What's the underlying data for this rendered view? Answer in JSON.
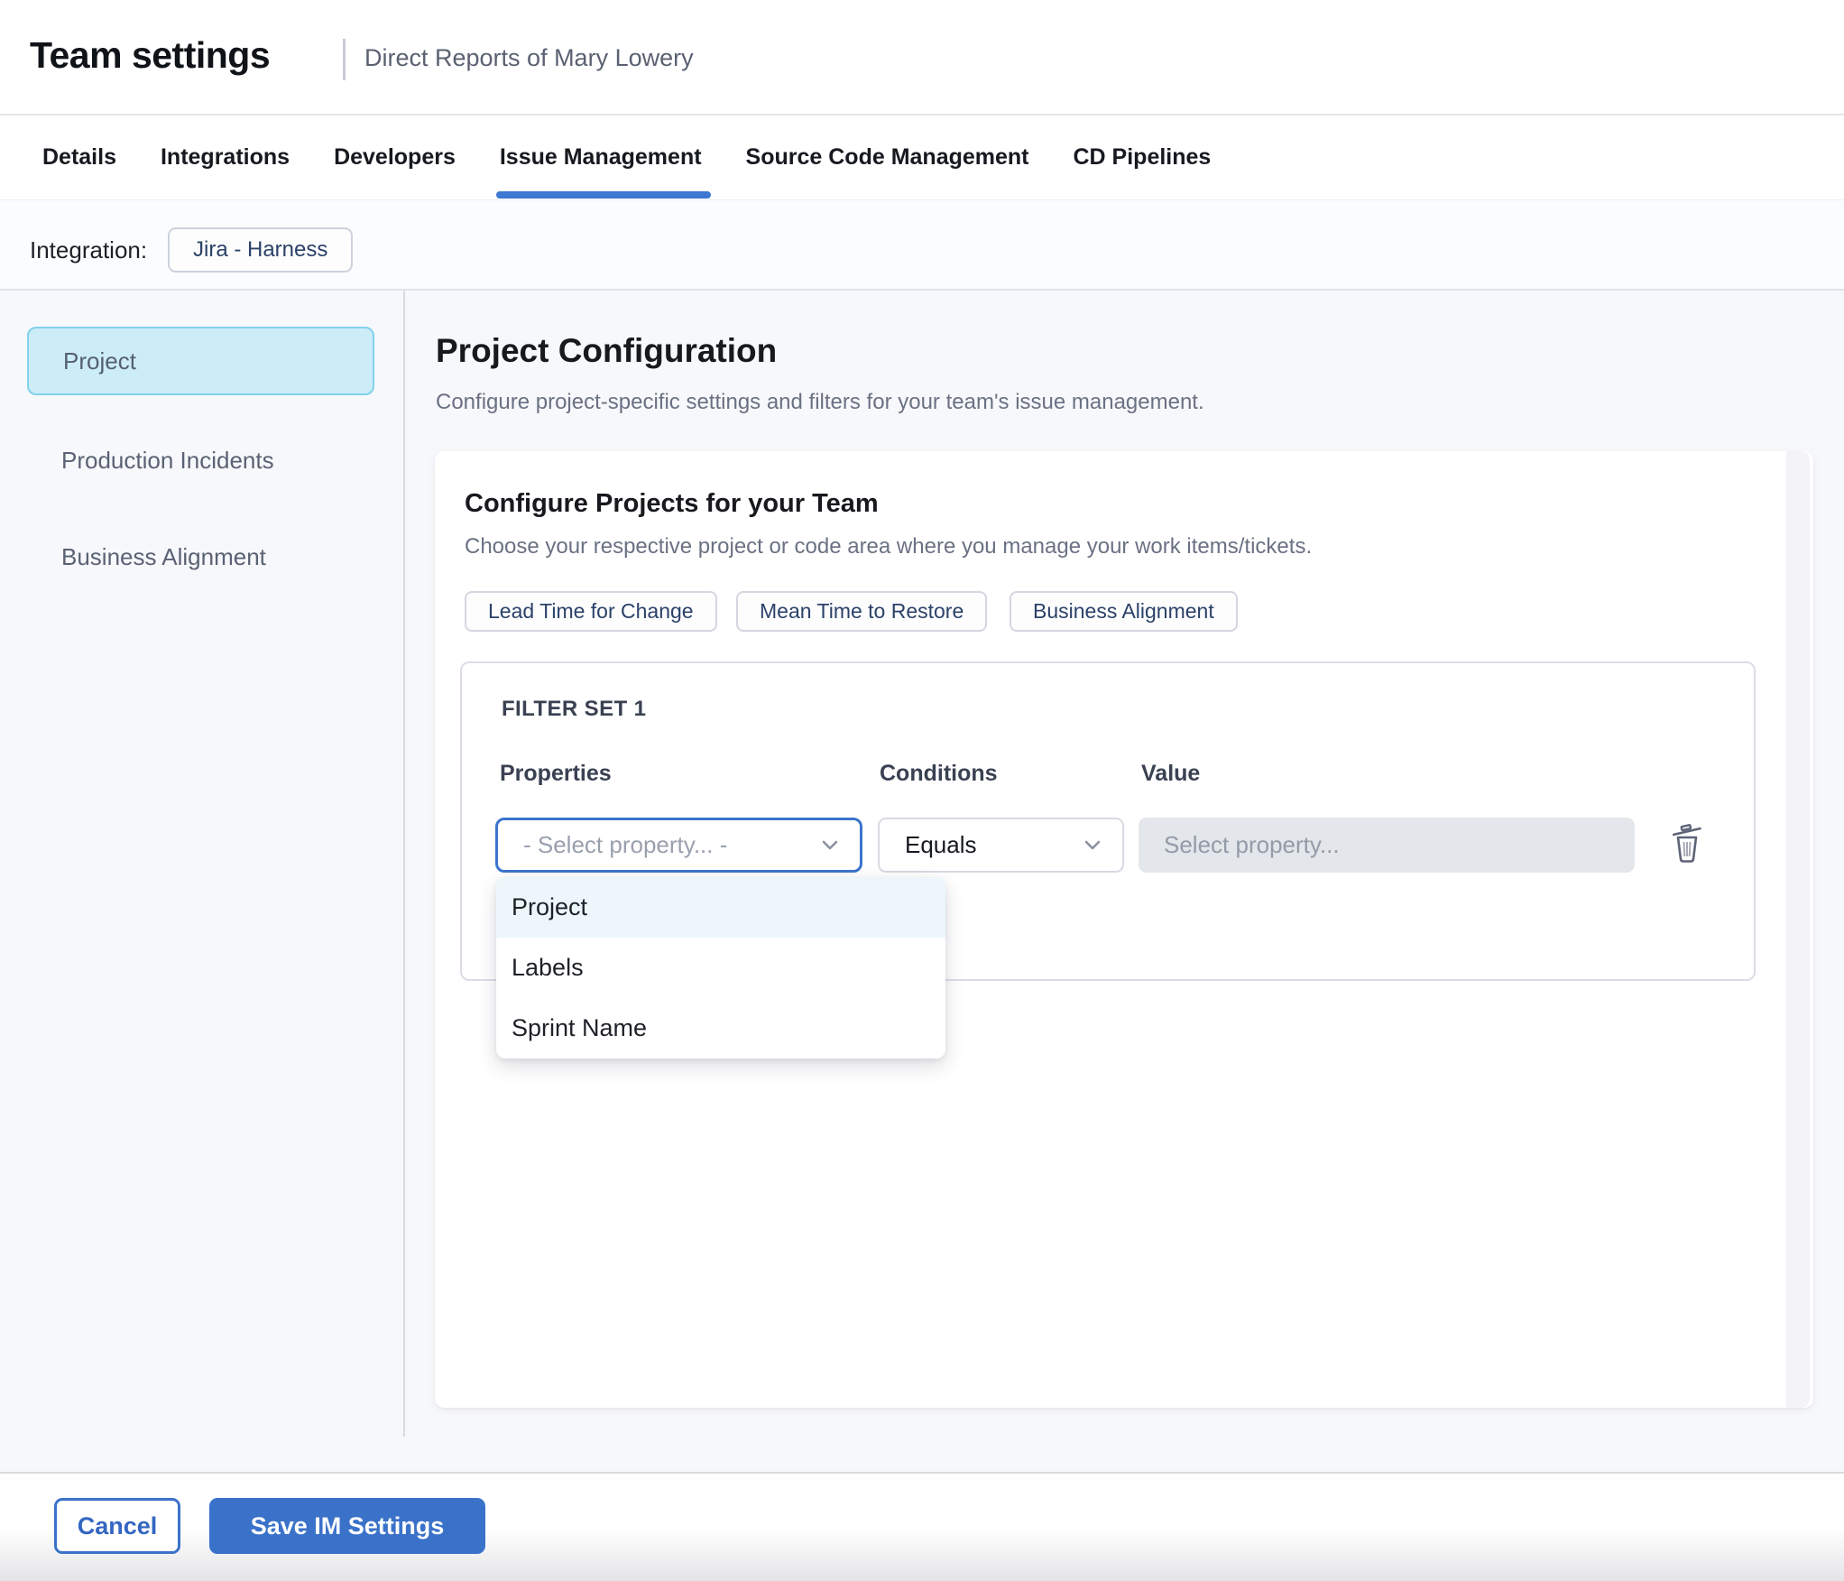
{
  "header": {
    "title": "Team settings",
    "subtitle": "Direct Reports of Mary Lowery"
  },
  "tabs": [
    {
      "label": "Details",
      "active": false
    },
    {
      "label": "Integrations",
      "active": false
    },
    {
      "label": "Developers",
      "active": false
    },
    {
      "label": "Issue Management",
      "active": true
    },
    {
      "label": "Source Code Management",
      "active": false
    },
    {
      "label": "CD Pipelines",
      "active": false
    }
  ],
  "integration": {
    "label": "Integration:",
    "chip": "Jira - Harness"
  },
  "sidebar": {
    "items": [
      {
        "label": "Project",
        "active": true
      },
      {
        "label": "Production Incidents",
        "active": false
      },
      {
        "label": "Business Alignment",
        "active": false
      }
    ]
  },
  "main": {
    "heading": "Project Configuration",
    "description": "Configure project-specific settings and filters for your team's issue management.",
    "card": {
      "title": "Configure Projects for your Team",
      "description": "Choose your respective project or code area where you manage your work items/tickets.",
      "chips": [
        "Lead Time for Change",
        "Mean Time to Restore",
        "Business Alignment"
      ],
      "filter_set": {
        "title": "FILTER SET 1",
        "columns": [
          "Properties",
          "Conditions",
          "Value"
        ],
        "property_placeholder": "- Select property... -",
        "condition_value": "Equals",
        "value_placeholder": "Select property...",
        "dropdown_options": [
          {
            "label": "Project",
            "highlighted": true
          },
          {
            "label": "Labels",
            "highlighted": false
          },
          {
            "label": "Sprint Name",
            "highlighted": false
          }
        ]
      }
    }
  },
  "footer": {
    "cancel_label": "Cancel",
    "save_label": "Save IM Settings"
  },
  "colors": {
    "primary_blue": "#3b72c9",
    "tab_underline": "#3d78d2",
    "sidebar_active_bg": "#ccecf8",
    "sidebar_active_border": "#82d1ec",
    "dropdown_highlight_bg": "#ecf6fb",
    "value_input_bg": "#e3e6ea",
    "page_bg": "#f7f8fb"
  }
}
